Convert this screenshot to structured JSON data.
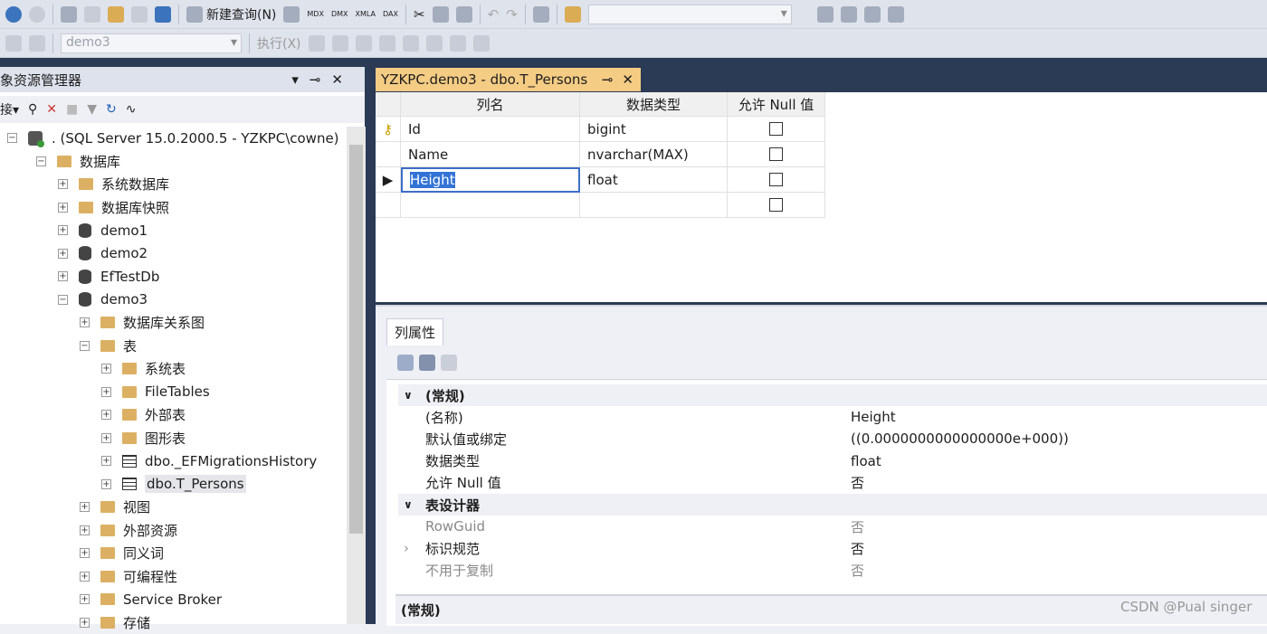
{
  "toolbar": {
    "new_query": "新建查询(N)",
    "mdx": "MDX",
    "dmx": "DMX",
    "xmla": "XMLA",
    "dax": "DAX",
    "database": "demo3",
    "execute": "执行(X)"
  },
  "object_explorer": {
    "title": "象资源管理器",
    "connect": "接▾",
    "tree": [
      {
        "label": ". (SQL Server 15.0.2000.5 - YZKPC\\cowne)",
        "level": 0,
        "icon": "server-icon",
        "expander": "-"
      },
      {
        "label": "数据库",
        "level": 1,
        "icon": "folder-icon",
        "expander": "-"
      },
      {
        "label": "系统数据库",
        "level": 2,
        "icon": "folder-icon",
        "expander": "+"
      },
      {
        "label": "数据库快照",
        "level": 2,
        "icon": "folder-icon",
        "expander": "+"
      },
      {
        "label": "demo1",
        "level": 2,
        "icon": "database-icon",
        "expander": "+"
      },
      {
        "label": "demo2",
        "level": 2,
        "icon": "database-icon",
        "expander": "+"
      },
      {
        "label": "EfTestDb",
        "level": 2,
        "icon": "database-icon",
        "expander": "+"
      },
      {
        "label": "demo3",
        "level": 2,
        "icon": "database-icon",
        "expander": "-"
      },
      {
        "label": "数据库关系图",
        "level": 3,
        "icon": "folder-icon",
        "expander": "+"
      },
      {
        "label": "表",
        "level": 3,
        "icon": "folder-icon",
        "expander": "-"
      },
      {
        "label": "系统表",
        "level": 4,
        "icon": "folder-icon",
        "expander": "+"
      },
      {
        "label": "FileTables",
        "level": 4,
        "icon": "folder-icon",
        "expander": "+"
      },
      {
        "label": "外部表",
        "level": 4,
        "icon": "folder-icon",
        "expander": "+"
      },
      {
        "label": "图形表",
        "level": 4,
        "icon": "folder-icon",
        "expander": "+"
      },
      {
        "label": "dbo._EFMigrationsHistory",
        "level": 4,
        "icon": "table-icon",
        "expander": "+"
      },
      {
        "label": "dbo.T_Persons",
        "level": 4,
        "icon": "table-icon",
        "expander": "+",
        "selected": true
      },
      {
        "label": "视图",
        "level": 3,
        "icon": "folder-icon",
        "expander": "+"
      },
      {
        "label": "外部资源",
        "level": 3,
        "icon": "folder-icon",
        "expander": "+"
      },
      {
        "label": "同义词",
        "level": 3,
        "icon": "folder-icon",
        "expander": "+"
      },
      {
        "label": "可编程性",
        "level": 3,
        "icon": "folder-icon",
        "expander": "+"
      },
      {
        "label": "Service Broker",
        "level": 3,
        "icon": "folder-icon",
        "expander": "+"
      },
      {
        "label": "存储",
        "level": 3,
        "icon": "folder-icon",
        "expander": "+"
      }
    ]
  },
  "tab": {
    "title": "YZKPC.demo3 - dbo.T_Persons",
    "pin": "⊸",
    "close": "✕"
  },
  "designer": {
    "headers": [
      "列名",
      "数据类型",
      "允许 Null 值"
    ],
    "rows": [
      {
        "name": "Id",
        "type": "bigint",
        "nullable": false,
        "key": true
      },
      {
        "name": "Name",
        "type": "nvarchar(MAX)",
        "nullable": false
      },
      {
        "name": "Height",
        "type": "float",
        "nullable": false,
        "current": true
      },
      {
        "name": "",
        "type": "",
        "nullable": false
      }
    ]
  },
  "properties": {
    "tab": "列属性",
    "items": [
      {
        "name": "(常规)",
        "value": "",
        "category": true
      },
      {
        "name": "(名称)",
        "value": "Height"
      },
      {
        "name": "默认值或绑定",
        "value": "((0.0000000000000000e+000))"
      },
      {
        "name": "数据类型",
        "value": "float"
      },
      {
        "name": "允许 Null 值",
        "value": "否"
      },
      {
        "name": "表设计器",
        "value": "",
        "category": true
      },
      {
        "name": "RowGuid",
        "value": "否",
        "disabled": true
      },
      {
        "name": "标识规范",
        "value": "否",
        "expandable": true
      },
      {
        "name": "不用于复制",
        "value": "否",
        "disabled": true
      }
    ],
    "description": "(常规)"
  },
  "watermark": "CSDN @Pual singer"
}
